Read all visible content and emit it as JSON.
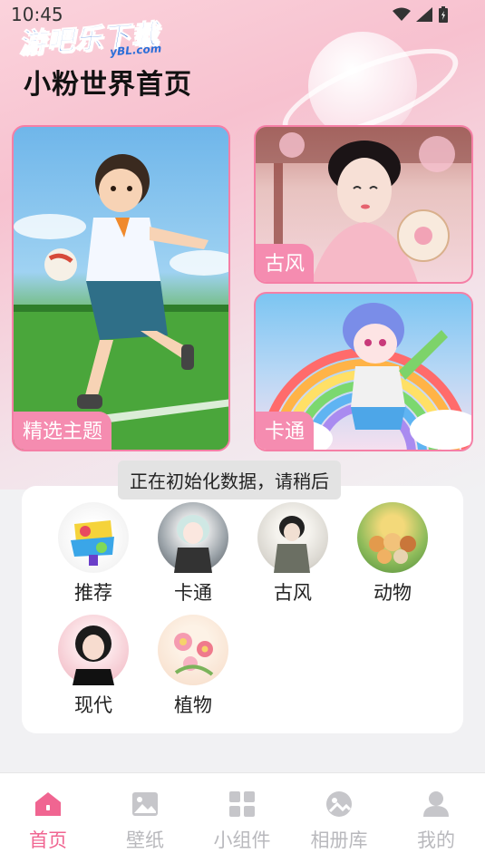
{
  "status_bar": {
    "time": "10:45"
  },
  "watermark": {
    "text": "游吧乐下载",
    "subtext": "yBL.com"
  },
  "page_title": "小粉世界首页",
  "cards": {
    "featured": {
      "label": "精选主题"
    },
    "guofeng": {
      "label": "古风"
    },
    "cartoon": {
      "label": "卡通"
    }
  },
  "toast": "正在初始化数据，请稍后",
  "categories": [
    {
      "label": "推荐",
      "icon": "graffiti-thumb"
    },
    {
      "label": "卡通",
      "icon": "anime-girl-thumb"
    },
    {
      "label": "古风",
      "icon": "ancient-girl-thumb"
    },
    {
      "label": "动物",
      "icon": "animals-thumb"
    },
    {
      "label": "现代",
      "icon": "modern-woman-thumb"
    },
    {
      "label": "植物",
      "icon": "flowers-thumb"
    }
  ],
  "tabbar": [
    {
      "label": "首页",
      "icon": "home-icon",
      "active": true
    },
    {
      "label": "壁纸",
      "icon": "image-icon",
      "active": false
    },
    {
      "label": "小组件",
      "icon": "widgets-icon",
      "active": false
    },
    {
      "label": "相册库",
      "icon": "album-icon",
      "active": false
    },
    {
      "label": "我的",
      "icon": "user-icon",
      "active": false
    }
  ],
  "colors": {
    "accent": "#f06591",
    "tag_bg": "#f58cb0",
    "inactive": "#b9b9bd"
  }
}
